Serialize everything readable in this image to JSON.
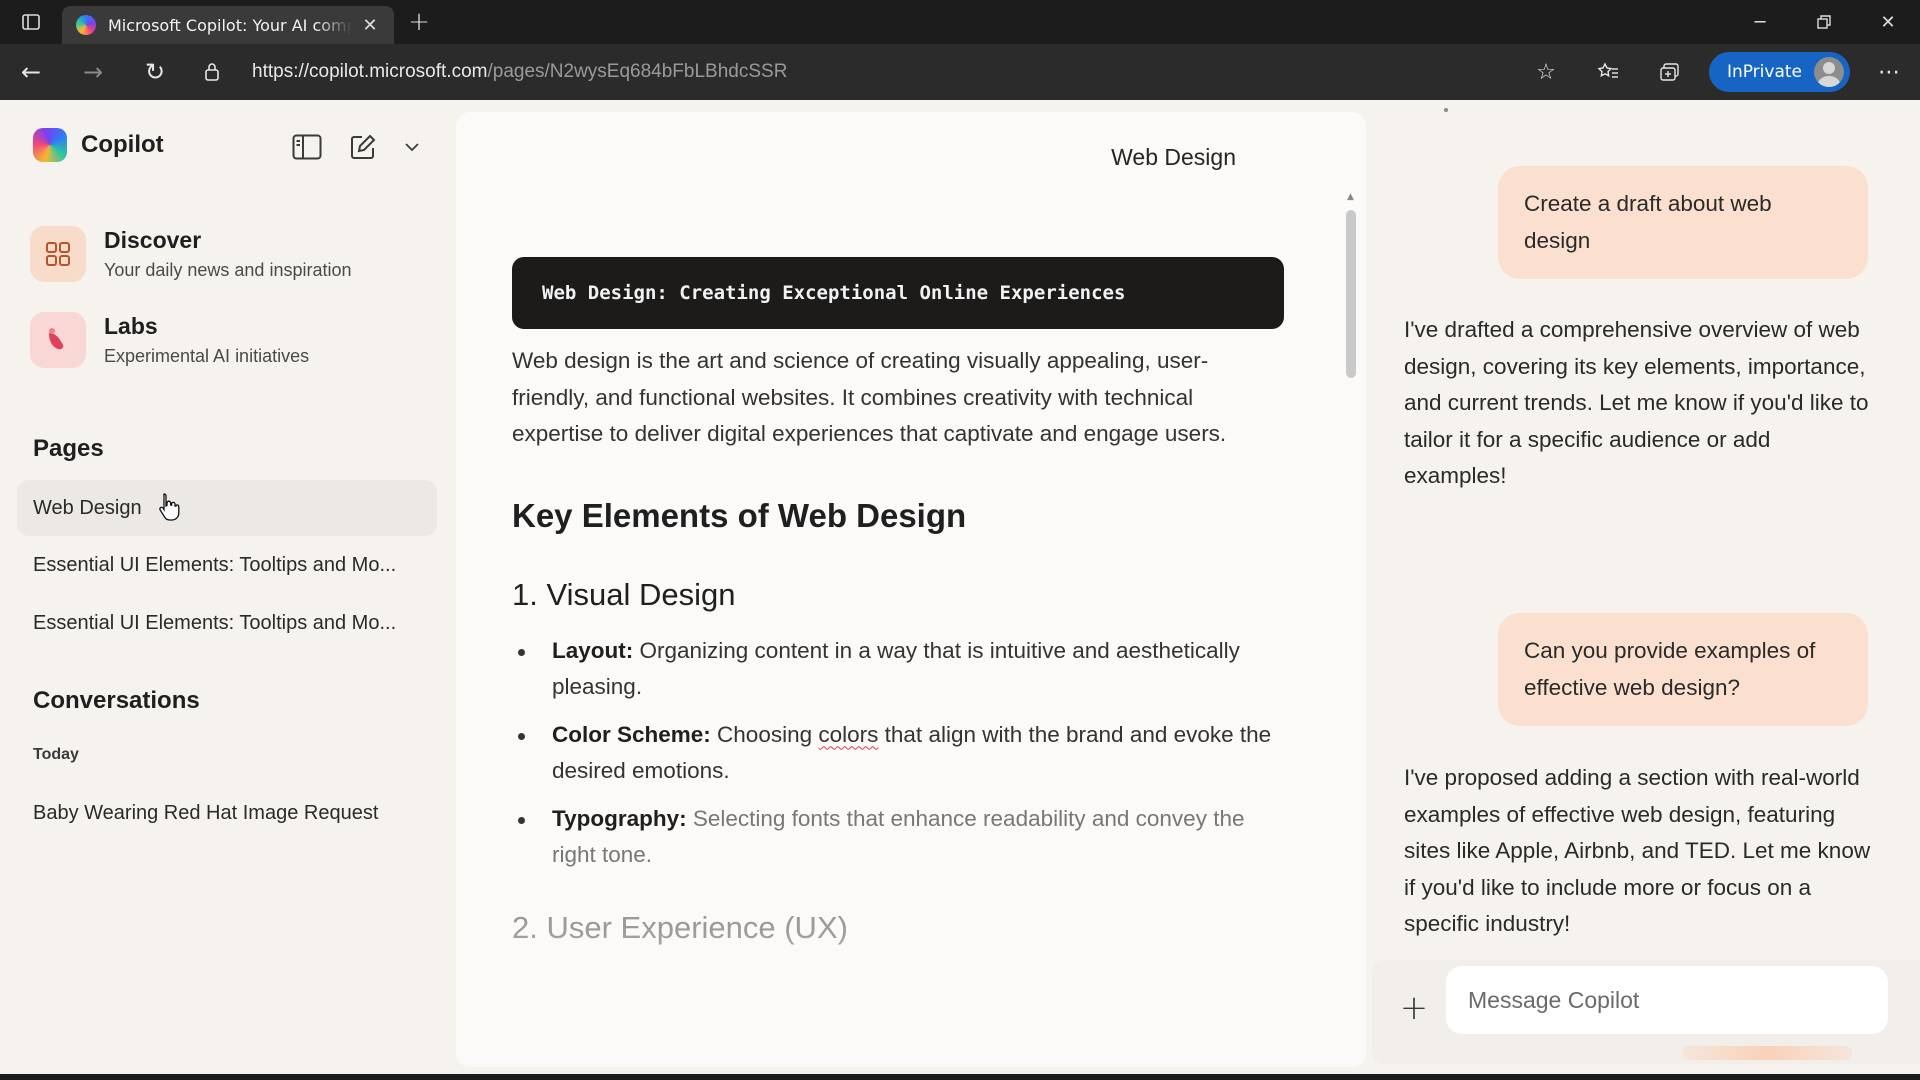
{
  "browser": {
    "tab_title": "Microsoft Copilot: Your AI companion",
    "url_domain": "https://copilot.microsoft.com",
    "url_path": "/pages/N2wysEq684bFbLBhdcSSR",
    "inprivate_label": "InPrivate"
  },
  "sidebar": {
    "brand": "Copilot",
    "nav": [
      {
        "title": "Discover",
        "subtitle": "Your daily news and inspiration"
      },
      {
        "title": "Labs",
        "subtitle": "Experimental AI initiatives"
      }
    ],
    "pages_heading": "Pages",
    "pages": [
      {
        "label": "Web Design"
      },
      {
        "label": "Essential UI Elements: Tooltips and Mo..."
      },
      {
        "label": "Essential UI Elements: Tooltips and Mo..."
      }
    ],
    "conversations_heading": "Conversations",
    "today_label": "Today",
    "conversations": [
      {
        "label": "Baby Wearing Red Hat Image Request"
      }
    ]
  },
  "document": {
    "title": "Web Design",
    "code_heading": "Web Design: Creating Exceptional Online Experiences",
    "intro": "Web design is the art and science of creating visually appealing, user-friendly, and functional websites. It combines creativity with technical expertise to deliver digital experiences that captivate and engage users.",
    "section_heading": "Key Elements of Web Design",
    "sub1": "1. Visual Design",
    "bullets": [
      {
        "term": "Layout:",
        "text": " Organizing content in a way that is intuitive and aesthetically pleasing."
      },
      {
        "term": "Color Scheme:",
        "text_before": " Choosing ",
        "squiggle": "colors",
        "text_after": " that align with the brand and evoke the desired emotions."
      },
      {
        "term": "Typography:",
        "text": " Selecting fonts that enhance readability and convey the right tone."
      }
    ],
    "sub2": "2. User Experience (UX)"
  },
  "chat": {
    "messages": [
      {
        "role": "user",
        "text": "Create a draft about web design"
      },
      {
        "role": "assistant",
        "text": "I've drafted a comprehensive overview of web design, covering its key elements, importance, and current trends. Let me know if you'd like to tailor it for a specific audience or add examples!"
      },
      {
        "role": "user",
        "text": "Can you provide examples of effective web design?"
      },
      {
        "role": "assistant",
        "text": "I've proposed adding a section with real-world examples of effective web design, featuring sites like Apple, Airbnb, and TED. Let me know if you'd like to include more or focus on a specific industry!"
      }
    ],
    "composer_placeholder": "Message Copilot"
  }
}
